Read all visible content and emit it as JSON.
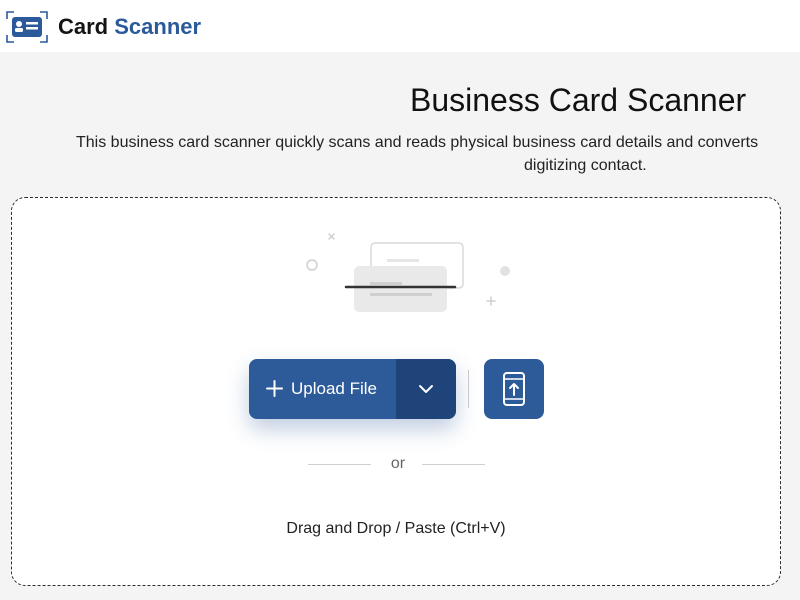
{
  "header": {
    "logo_word1": "Card",
    "logo_word2": "Scanner",
    "logo_icon": "id-card-icon"
  },
  "main": {
    "title": "Business Card Scanner",
    "description_line1": "This business card scanner quickly scans and reads physical business card details and converts",
    "description_line2": "digitizing contact."
  },
  "dropzone": {
    "illustration_icon": "scanning-card-illustration",
    "upload_label": "Upload File",
    "upload_icon": "plus-icon",
    "dropdown_icon": "chevron-down-icon",
    "mobile_icon": "mobile-upload-icon",
    "or_text": "or",
    "drag_text": "Drag and Drop / Paste (Ctrl+V)"
  },
  "colors": {
    "brand": "#2b5a9b",
    "button": "#2d5b99",
    "button_dark": "#1f4479",
    "page_bg": "#f4f4f4"
  }
}
